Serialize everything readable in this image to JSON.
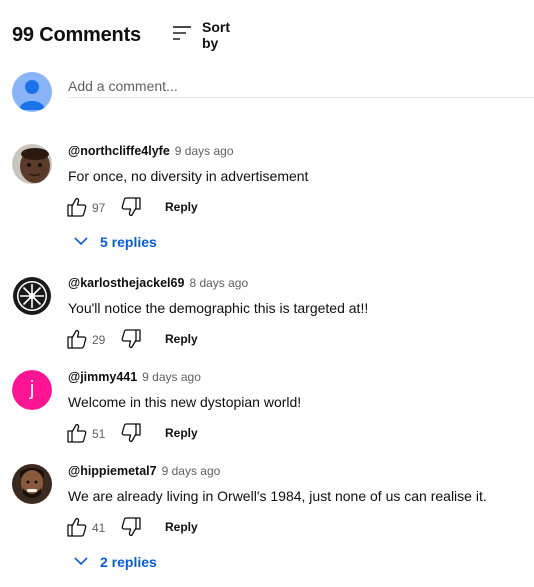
{
  "header": {
    "comment_count": "99 Comments",
    "sort_label": "Sort by"
  },
  "add_comment": {
    "placeholder": "Add a comment..."
  },
  "comments": [
    {
      "author": "@northcliffe4lyfe",
      "time": "9 days ago",
      "text": "For once, no diversity in advertisement",
      "likes": "97",
      "reply_label": "Reply",
      "replies_label": "5 replies",
      "avatar": "photo-face"
    },
    {
      "author": "@karlosthejackel69",
      "time": "8 days ago",
      "text": "You'll notice the demographic this is targeted at!!",
      "likes": "29",
      "reply_label": "Reply",
      "avatar": "emblem"
    },
    {
      "author": "@jimmy441",
      "time": "9 days ago",
      "text": "Welcome in this new dystopian world!",
      "likes": "51",
      "reply_label": "Reply",
      "avatar_letter": "j",
      "avatar_color": "#ff1493"
    },
    {
      "author": "@hippiemetal7",
      "time": "9 days ago",
      "text": "We are already living in Orwell's 1984, just none of us can realise it.",
      "likes": "41",
      "reply_label": "Reply",
      "replies_label": "2 replies",
      "avatar": "photo-person"
    }
  ],
  "colors": {
    "link_blue": "#065fd4",
    "secondary_text": "#606060",
    "default_avatar": "#8ab4f8"
  }
}
